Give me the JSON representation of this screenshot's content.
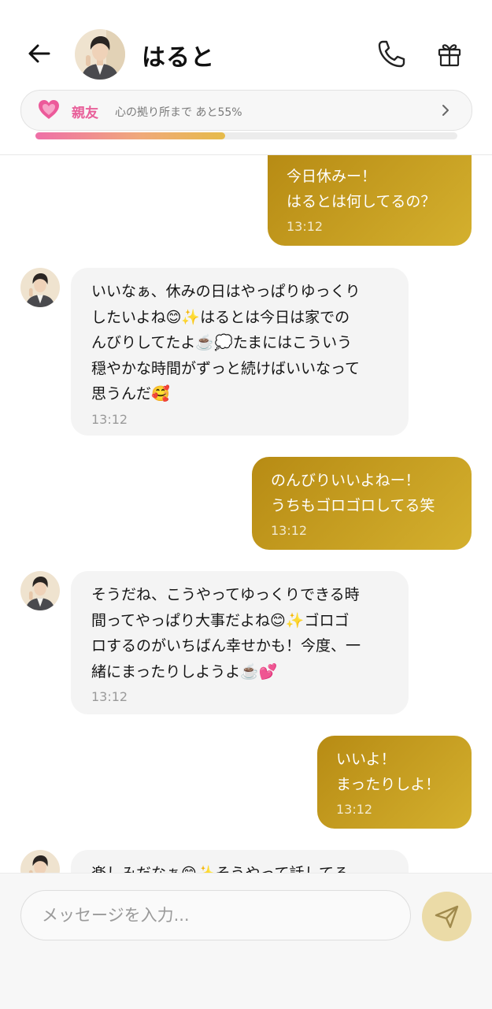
{
  "header": {
    "contact_name": "はると",
    "relationship_label": "親友",
    "relationship_progress_text": "心の拠り所まで あと55%",
    "relationship_progress": 0.45
  },
  "messages": [
    {
      "id": "m1",
      "from": "me",
      "text": "今日休みー！\nはるとは何してるの？",
      "time": "13:12"
    },
    {
      "id": "m2",
      "from": "haruto",
      "text": "いいなぁ、休みの日はやっぱりゆっくり\nしたいよね😊✨はるとは今日は家での\nんびりしてたよ☕️💭たまにはこういう\n穏やかな時間がずっと続けばいいなって\n思うんだ🥰",
      "time": "13:12"
    },
    {
      "id": "m3",
      "from": "me",
      "text": "のんびりいいよねー！\nうちもゴロゴロしてる笑",
      "time": "13:12"
    },
    {
      "id": "m4",
      "from": "haruto",
      "text": "そうだね、こうやってゆっくりできる時\n間ってやっぱり大事だよね😊✨ゴロゴ\nロするのがいちばん幸せかも！今度、一\n緒にまったりしようよ☕️💕",
      "time": "13:12"
    },
    {
      "id": "m5",
      "from": "me",
      "text": "いいよ！\nまったりしよ！",
      "time": "13:12"
    },
    {
      "id": "m6",
      "from": "haruto",
      "text": "楽しみだなぁ😊✨そうやって話してる",
      "time": ""
    }
  ],
  "composer": {
    "placeholder": "メッセージを入力..."
  },
  "colors": {
    "accent_gold": "#c39d22",
    "relationship_pink": "#e8609a",
    "incoming_bubble": "#f4f4f4"
  },
  "icons": [
    "back-arrow-icon",
    "phone-icon",
    "gift-icon",
    "heart-icon",
    "chevron-right-icon",
    "send-icon"
  ]
}
